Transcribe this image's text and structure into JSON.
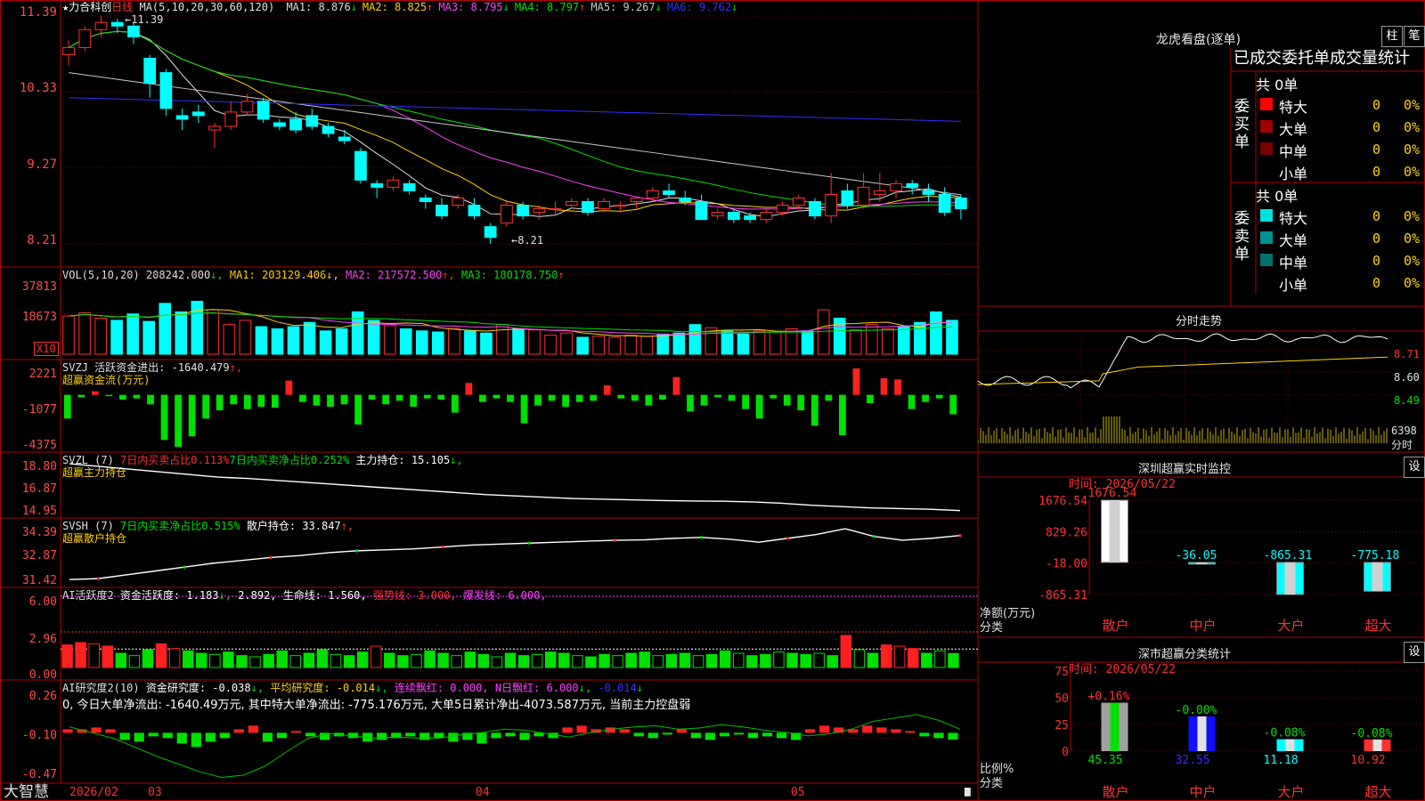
{
  "main": {
    "stock_name": "★力合科创",
    "period": "日线",
    "ma_prefix": "MA(5,10,20,30,60,120)",
    "ma": [
      {
        "label": "MA1:",
        "value": "8.876",
        "arrow": "↓",
        "color": "#dcdcdc"
      },
      {
        "label": "MA2:",
        "value": "8.825",
        "arrow": "↑",
        "color": "#ffd200"
      },
      {
        "label": "MA3:",
        "value": "8.795",
        "arrow": "↓",
        "color": "#ff40ff"
      },
      {
        "label": "MA4:",
        "value": "8.797",
        "arrow": "↑",
        "color": "#00e000"
      },
      {
        "label": "MA5:",
        "value": "9.267",
        "arrow": "↓",
        "color": "#c8c8c8"
      },
      {
        "label": "MA6:",
        "value": "9.762",
        "arrow": "↓",
        "color": "#3030ff"
      }
    ],
    "y_ticks": [
      "11.39",
      "10.33",
      "9.27",
      "8.21"
    ],
    "high_label": "11.39",
    "low_label": "8.21"
  },
  "vol": {
    "title": "VOL(5,10,20)",
    "value": "208242.000",
    "ma1": "MA1: 203129.406",
    "ma2": "MA2: 217572.500",
    "ma3": "MA3: 180178.750",
    "y_ticks": [
      "37813",
      "18673"
    ],
    "unit": "X10"
  },
  "svzj": {
    "title": "SVZJ",
    "line1": "活跃资金进出: -1640.479",
    "line2": "超赢资金流(万元)",
    "y_ticks": [
      "2221",
      "-1077",
      "-4375"
    ]
  },
  "svzl": {
    "title": "SVZL (7)",
    "p1": "7日内买卖占比0.113%",
    "p2": "7日内买卖净占比0.252%",
    "p3": "主力持仓: 15.105",
    "sub": "超赢主力持仓",
    "y_ticks": [
      "18.80",
      "16.87",
      "14.95"
    ]
  },
  "svsh": {
    "title": "SVSH (7)",
    "p1": "7日内买卖净占比0.515%",
    "p2": "散户持仓: 33.847",
    "sub": "超赢散户持仓",
    "y_ticks": [
      "34.39",
      "32.87",
      "31.42"
    ]
  },
  "ai_act": {
    "title": "AI活跃度2",
    "p1": "资金活跃度: 1.183",
    "p2": "2.892,",
    "p3": "生命线: 1.560,",
    "p4": "强势线: 3.000,",
    "p5": "爆发线: 6.000,",
    "y_ticks": [
      "6.00",
      "2.96",
      "0.00"
    ]
  },
  "ai_res": {
    "title": "AI研究度2(10)",
    "p1": "资金研究度: -0.038",
    "p2": "平均研究度: -0.014",
    "p3": "连续飘红: 0.000,",
    "p4": "N日飘红: 6.000",
    "p5": "-0.014",
    "summary": "0, 今日大单净流出: -1640.49万元, 其中特大单净流出: -775.176万元, 大单5日累计净出-4073.587万元, 当前主力控盘弱",
    "y_ticks": [
      "0.26",
      "-0.10",
      "-0.47"
    ]
  },
  "footer": {
    "brand": "大智慧",
    "dates": [
      "2026/02",
      "03",
      "04",
      "05"
    ]
  },
  "lhb": {
    "title": "龙虎看盘(逐单)",
    "btn_bar": "柱",
    "btn_pen": "笔",
    "header": "已成交委托单成交量统计",
    "buy_label": "委买单",
    "sell_label": "委卖单",
    "buy_total": "共 0单",
    "sell_total": "共 0单",
    "buy_rows": [
      {
        "name": "特大",
        "count": "0",
        "pct": "0%",
        "color": "#ff0000"
      },
      {
        "name": "大单",
        "count": "0",
        "pct": "0%",
        "color": "#a00000"
      },
      {
        "name": "中单",
        "count": "0",
        "pct": "0%",
        "color": "#780000"
      },
      {
        "name": "小单",
        "count": "0",
        "pct": "0%",
        "color": "#000000"
      }
    ],
    "sell_rows": [
      {
        "name": "特大",
        "count": "0",
        "pct": "0%",
        "color": "#00e0e0"
      },
      {
        "name": "大单",
        "count": "0",
        "pct": "0%",
        "color": "#009090"
      },
      {
        "name": "中单",
        "count": "0",
        "pct": "0%",
        "color": "#007070"
      },
      {
        "name": "小单",
        "count": "0",
        "pct": "0%",
        "color": "#000000"
      }
    ]
  },
  "intraday": {
    "title": "分时走势",
    "prices": [
      "8.71",
      "8.60",
      "8.49"
    ],
    "vol_label": "6398",
    "vol_unit": "分时"
  },
  "sz_monitor": {
    "title": "深圳超赢实时监控",
    "btn": "设",
    "time": "时间: 2026/05/22",
    "y_ticks": [
      "1676.54",
      "829.26",
      "-18.00",
      "-865.31"
    ],
    "y_axis_name": "净额(万元)",
    "x_axis_name": "分类",
    "categories": [
      "散户",
      "中户",
      "大户",
      "超大"
    ],
    "values": [
      1676.54,
      -36.05,
      -865.31,
      -775.18
    ],
    "value_labels": [
      "1676.54",
      "-36.05",
      "-865.31",
      "-775.18"
    ]
  },
  "sz_class": {
    "title": "深市超赢分类统计",
    "btn": "设",
    "time": "时间: 2026/05/22",
    "y_ticks": [
      "75",
      "50",
      "25",
      "0"
    ],
    "y_axis_name": "比例%",
    "x_axis_name": "分类",
    "categories": [
      "散户",
      "中户",
      "大户",
      "超大"
    ],
    "values": [
      45.35,
      32.55,
      11.18,
      10.92
    ],
    "value_labels": [
      "45.35",
      "32.55",
      "11.18",
      "10.92"
    ],
    "change_labels": [
      "+0.16%",
      "-0.00%",
      "-0.08%",
      "-0.08%"
    ]
  },
  "chart_data": [
    {
      "type": "candlestick",
      "title": "★力合科创 日线",
      "ylim": [
        8.21,
        11.39
      ],
      "y_ticks": [
        11.39,
        10.33,
        9.27,
        8.21
      ],
      "x_ticks": [
        "2026/02",
        "03",
        "04",
        "05"
      ],
      "ohlc": [
        [
          10.85,
          11.05,
          10.7,
          10.95
        ],
        [
          10.95,
          11.25,
          10.9,
          11.2
        ],
        [
          11.2,
          11.39,
          11.1,
          11.3
        ],
        [
          11.3,
          11.35,
          11.15,
          11.25
        ],
        [
          11.25,
          11.3,
          11.0,
          11.1
        ],
        [
          10.8,
          10.85,
          10.25,
          10.45
        ],
        [
          10.6,
          10.65,
          10.0,
          10.1
        ],
        [
          10.0,
          10.1,
          9.8,
          9.95
        ],
        [
          10.05,
          10.15,
          9.9,
          10.0
        ],
        [
          9.8,
          9.9,
          9.55,
          9.85
        ],
        [
          9.85,
          10.2,
          9.8,
          10.05
        ],
        [
          10.05,
          10.3,
          10.0,
          10.2
        ],
        [
          10.2,
          10.25,
          9.9,
          9.95
        ],
        [
          9.9,
          9.95,
          9.8,
          9.85
        ],
        [
          9.95,
          10.05,
          9.75,
          9.8
        ],
        [
          10.0,
          10.1,
          9.8,
          9.85
        ],
        [
          9.85,
          9.9,
          9.7,
          9.75
        ],
        [
          9.7,
          9.8,
          9.6,
          9.65
        ],
        [
          9.5,
          9.55,
          9.05,
          9.1
        ],
        [
          9.05,
          9.1,
          8.85,
          9.0
        ],
        [
          9.0,
          9.15,
          8.95,
          9.1
        ],
        [
          9.05,
          9.1,
          8.9,
          8.95
        ],
        [
          8.85,
          8.9,
          8.7,
          8.8
        ],
        [
          8.75,
          8.85,
          8.55,
          8.6
        ],
        [
          8.75,
          8.9,
          8.7,
          8.85
        ],
        [
          8.75,
          8.85,
          8.55,
          8.6
        ],
        [
          8.45,
          8.5,
          8.21,
          8.3
        ],
        [
          8.5,
          8.8,
          8.45,
          8.75
        ],
        [
          8.75,
          8.8,
          8.55,
          8.6
        ],
        [
          8.65,
          8.75,
          8.55,
          8.7
        ],
        [
          8.7,
          8.8,
          8.6,
          8.7
        ],
        [
          8.75,
          8.85,
          8.7,
          8.8
        ],
        [
          8.8,
          8.85,
          8.6,
          8.65
        ],
        [
          8.7,
          8.85,
          8.65,
          8.8
        ],
        [
          8.75,
          8.8,
          8.65,
          8.75
        ],
        [
          8.8,
          8.85,
          8.7,
          8.85
        ],
        [
          8.85,
          9.0,
          8.8,
          8.95
        ],
        [
          8.95,
          9.05,
          8.85,
          8.9
        ],
        [
          8.85,
          8.95,
          8.75,
          8.8
        ],
        [
          8.8,
          8.9,
          8.55,
          8.55
        ],
        [
          8.6,
          8.7,
          8.55,
          8.65
        ],
        [
          8.65,
          8.7,
          8.5,
          8.55
        ],
        [
          8.6,
          8.65,
          8.5,
          8.55
        ],
        [
          8.55,
          8.7,
          8.5,
          8.65
        ],
        [
          8.65,
          8.8,
          8.6,
          8.75
        ],
        [
          8.75,
          8.9,
          8.7,
          8.85
        ],
        [
          8.8,
          8.85,
          8.55,
          8.6
        ],
        [
          8.6,
          9.2,
          8.5,
          8.9
        ],
        [
          8.95,
          9.05,
          8.7,
          8.75
        ],
        [
          8.75,
          9.2,
          8.7,
          9.0
        ],
        [
          8.9,
          9.2,
          8.8,
          8.95
        ],
        [
          8.95,
          9.1,
          8.85,
          9.05
        ],
        [
          9.05,
          9.1,
          8.9,
          9.0
        ],
        [
          8.95,
          9.05,
          8.8,
          8.9
        ],
        [
          8.9,
          9.0,
          8.6,
          8.65
        ],
        [
          8.85,
          8.9,
          8.55,
          8.7
        ]
      ]
    },
    {
      "type": "bar",
      "title": "VOL(5,10,20)",
      "ylim": [
        0,
        37813
      ],
      "unit": "X10",
      "values": [
        18000,
        19500,
        17000,
        16000,
        19000,
        15500,
        24000,
        20000,
        25000,
        21000,
        14000,
        16000,
        13000,
        12000,
        13000,
        15000,
        11000,
        12000,
        20000,
        16000,
        13500,
        12000,
        11000,
        10500,
        12000,
        11000,
        10000,
        14000,
        12000,
        11500,
        9000,
        10000,
        8000,
        8500,
        8000,
        9000,
        8500,
        9500,
        10000,
        14000,
        12500,
        11000,
        9500,
        11000,
        10500,
        12000,
        11000,
        21000,
        17000,
        11500,
        14000,
        12000,
        13000,
        15000,
        20000,
        16000
      ]
    },
    {
      "type": "bar",
      "title": "SVZJ 超赢资金流(万元)",
      "ylim": [
        -4375,
        2221
      ],
      "values": [
        -2000,
        -200,
        300,
        -100,
        -400,
        -300,
        -800,
        -3800,
        -4375,
        -3500,
        -2000,
        -1300,
        -800,
        -1200,
        -1000,
        -1077,
        1200,
        -600,
        -900,
        -1000,
        -800,
        -2500,
        -400,
        -800,
        -500,
        -1000,
        -300,
        -400,
        -1500,
        1000,
        -600,
        -300,
        -600,
        -2400,
        -900,
        -500,
        -1000,
        -600,
        -500,
        800,
        -300,
        -500,
        -900,
        -400,
        1500,
        -1400,
        -900,
        -200,
        -500,
        -1200,
        -2000,
        -300,
        -900,
        -1300,
        -2600,
        -500,
        -3400,
        2221,
        -700,
        1400,
        1300,
        -1200,
        -600,
        -300,
        -1640
      ]
    },
    {
      "type": "line",
      "title": "SVZL 主力持仓",
      "ylim": [
        14.95,
        18.8
      ],
      "values": [
        18.6,
        18.4,
        18.2,
        18.0,
        17.8,
        17.6,
        17.5,
        17.35,
        17.2,
        17.05,
        16.9,
        16.75,
        16.6,
        16.45,
        16.3,
        16.2,
        16.1,
        16.0,
        15.95,
        15.9,
        15.85,
        15.82,
        15.8,
        15.75,
        15.65,
        15.5,
        15.4,
        15.3,
        15.25,
        15.2,
        15.105
      ]
    },
    {
      "type": "line",
      "title": "SVSH 散户持仓",
      "ylim": [
        31.42,
        34.39
      ],
      "values": [
        31.55,
        31.6,
        31.8,
        32.0,
        32.2,
        32.4,
        32.55,
        32.7,
        32.8,
        32.95,
        33.05,
        33.1,
        33.15,
        33.25,
        33.35,
        33.4,
        33.45,
        33.5,
        33.55,
        33.6,
        33.62,
        33.7,
        33.75,
        33.65,
        33.5,
        33.7,
        33.9,
        34.2,
        33.8,
        33.6,
        33.7,
        33.847
      ]
    },
    {
      "type": "bar",
      "title": "深圳超赢实时监控",
      "categories": [
        "散户",
        "中户",
        "大户",
        "超大"
      ],
      "values": [
        1676.54,
        -36.05,
        -865.31,
        -775.18
      ],
      "ylim": [
        -865.31,
        1676.54
      ],
      "ylabel": "净额(万元)",
      "xlabel": "分类"
    },
    {
      "type": "bar",
      "title": "深市超赢分类统计",
      "categories": [
        "散户",
        "中户",
        "大户",
        "超大"
      ],
      "values": [
        45.35,
        32.55,
        11.18,
        10.92
      ],
      "ylim": [
        0,
        75
      ],
      "ylabel": "比例%",
      "xlabel": "分类"
    }
  ]
}
